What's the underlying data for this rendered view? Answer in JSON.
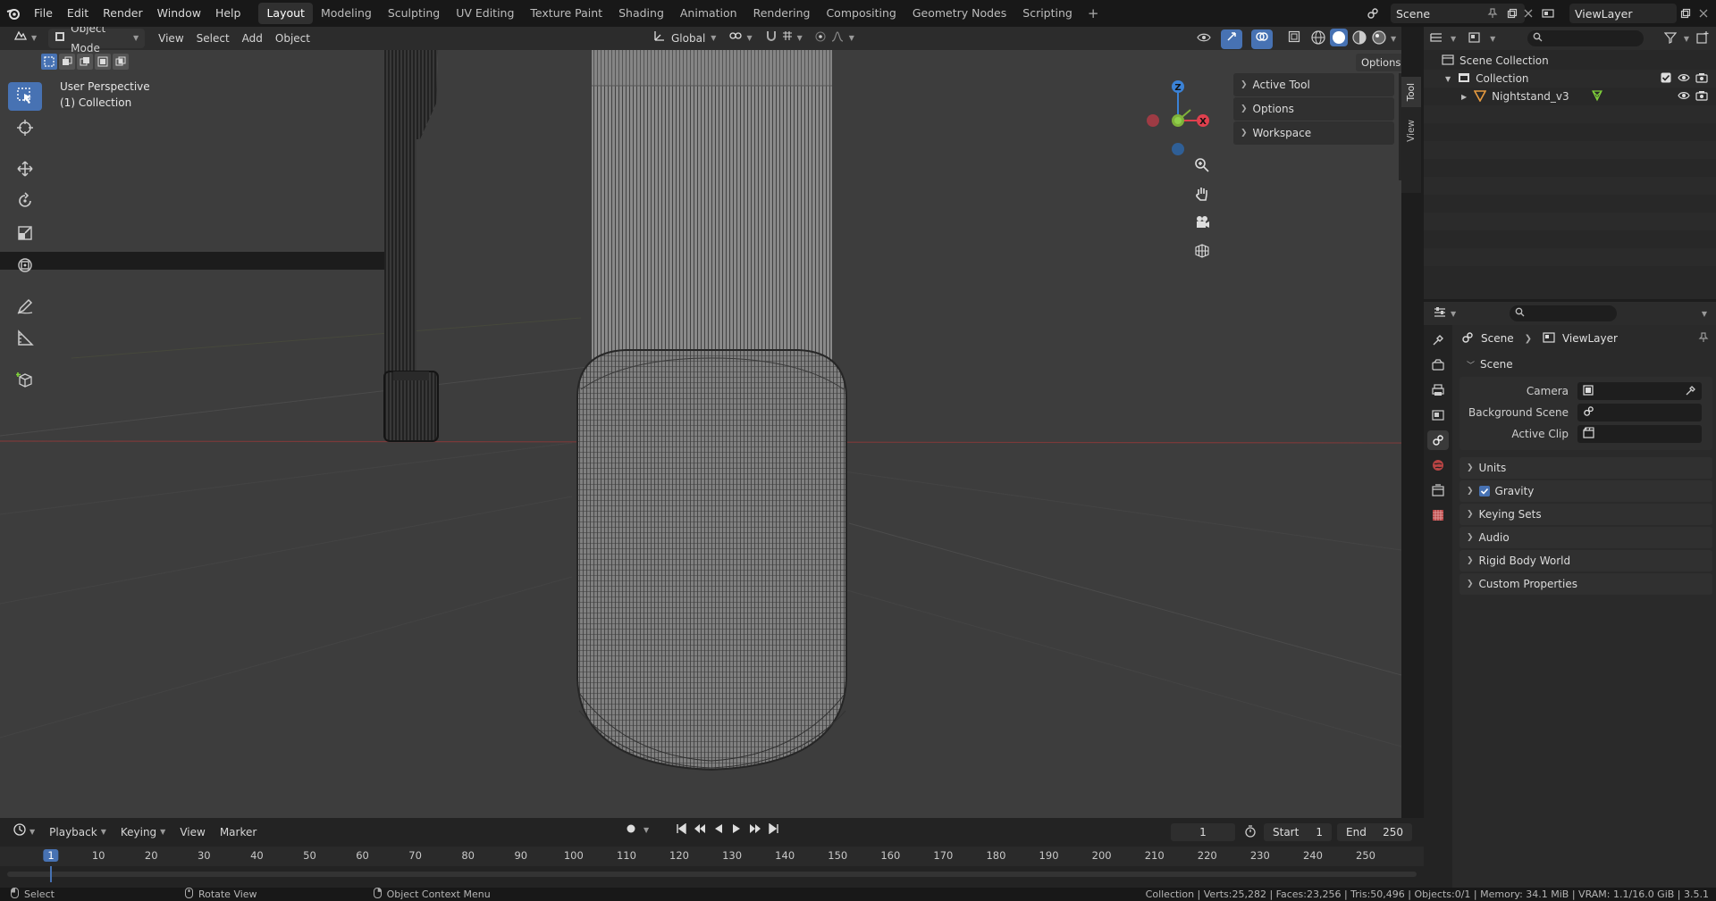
{
  "menu": {
    "items": [
      "File",
      "Edit",
      "Render",
      "Window",
      "Help"
    ]
  },
  "workspaces": {
    "tabs": [
      "Layout",
      "Modeling",
      "Sculpting",
      "UV Editing",
      "Texture Paint",
      "Shading",
      "Animation",
      "Rendering",
      "Compositing",
      "Geometry Nodes",
      "Scripting"
    ],
    "active": "Layout",
    "add": "+"
  },
  "top_right": {
    "scene": "Scene",
    "view_layer": "ViewLayer"
  },
  "viewport": {
    "mode": "Object Mode",
    "menus": [
      "View",
      "Select",
      "Add",
      "Object"
    ],
    "transform_orientation": "Global",
    "options_label": "Options",
    "perspective_label": "User Perspective",
    "collection_label": "(1) Collection",
    "gizmo_axes": {
      "z": "Z",
      "x": "X"
    },
    "sidebar_panels": [
      "Active Tool",
      "Options",
      "Workspace"
    ],
    "sidebar_tabs": [
      "Tool",
      "View"
    ]
  },
  "outliner": {
    "root": "Scene Collection",
    "collection": "Collection",
    "object": "Nightstand_v3"
  },
  "properties": {
    "breadcrumb": {
      "scene": "Scene",
      "view_layer": "ViewLayer"
    },
    "scene_panel": {
      "title": "Scene",
      "fields": [
        {
          "label": "Camera",
          "value": ""
        },
        {
          "label": "Background Scene",
          "value": ""
        },
        {
          "label": "Active Clip",
          "value": ""
        }
      ]
    },
    "panels": [
      "Units",
      "Gravity",
      "Keying Sets",
      "Audio",
      "Rigid Body World",
      "Custom Properties"
    ],
    "gravity_checked": true
  },
  "timeline": {
    "menus": [
      "Playback",
      "Keying",
      "View",
      "Marker"
    ],
    "current_frame": "1",
    "start_label": "Start",
    "start_value": "1",
    "end_label": "End",
    "end_value": "250",
    "ticks": [
      "1",
      "10",
      "20",
      "30",
      "40",
      "50",
      "60",
      "70",
      "80",
      "90",
      "100",
      "110",
      "120",
      "130",
      "140",
      "150",
      "160",
      "170",
      "180",
      "190",
      "200",
      "210",
      "220",
      "230",
      "240",
      "250"
    ]
  },
  "status": {
    "select": "Select",
    "rotate": "Rotate View",
    "context_menu": "Object Context Menu",
    "stats": "Collection | Verts:25,282 | Faces:23,256 | Tris:50,496 | Objects:0/1 | Memory: 34.1 MiB | VRAM: 1.1/16.0 GiB | 3.5.1"
  },
  "colors": {
    "accent": "#4772b3",
    "axis_x": "#e0404e",
    "axis_y": "#7fb13a",
    "axis_z": "#3b82d6",
    "viewport_bg": "#3d3d3d"
  }
}
